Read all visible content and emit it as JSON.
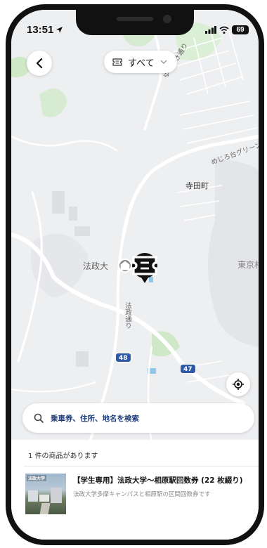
{
  "status_bar": {
    "time": "13:51",
    "battery": "69"
  },
  "map": {
    "labels": {
      "terada": "寺田町",
      "hosei": "法政大",
      "tokyo": "東京村",
      "yurinoki": "ゆりのき通り",
      "mejiro": "めじろ台グリーン",
      "houseidori": "法政通り"
    },
    "routes": [
      "48",
      "47"
    ]
  },
  "filter": {
    "label": "すべて"
  },
  "search": {
    "placeholder": "乗車券、住所、地名を検索"
  },
  "results": {
    "count_text": "1 件の商品があります",
    "items": [
      {
        "title": "【学生専用】法政大学〜相原駅回数券 (22 枚綴り)",
        "description": "法政大学多摩キャンパスと相原駅の区間回数券です",
        "thumbnail_label": "法政大学"
      }
    ]
  },
  "colors": {
    "accent_text": "#1f3e7a",
    "map_background": "#eeeff1",
    "route_badge": "#2f5aa8",
    "green_area": "#cfe8c8"
  },
  "icons": {
    "back": "chevron-left-icon",
    "filter": "ticket-icon",
    "dropdown": "chevron-down-icon",
    "locate": "location-target-icon",
    "search": "search-icon",
    "pin": "ticket-pin-icon"
  }
}
